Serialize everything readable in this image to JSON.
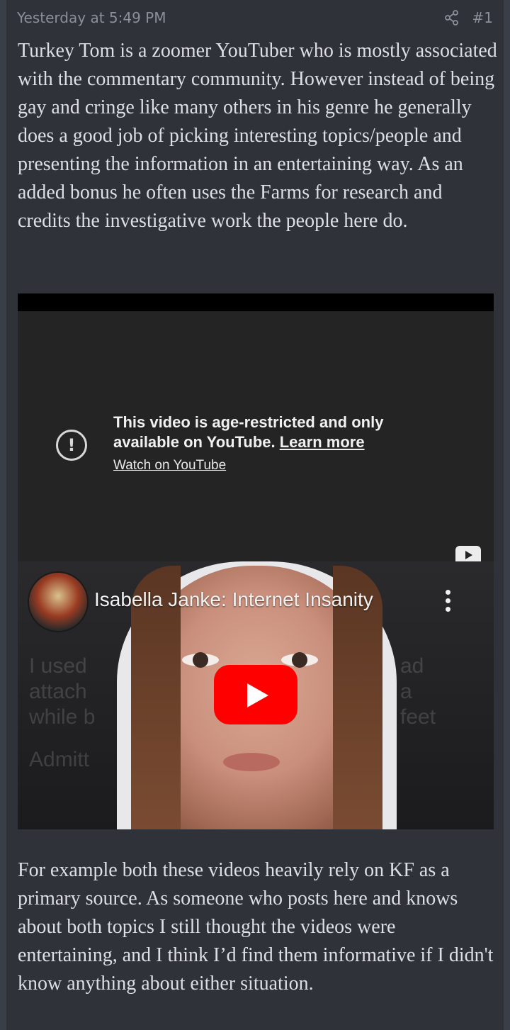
{
  "post": {
    "timestamp": "Yesterday at 5:49 PM",
    "post_number": "#1",
    "paragraph_1": "Turkey Tom is a zoomer YouTuber who is mostly associated with the commentary community. However instead of being gay and cringe like many others in his genre he generally does a good job of picking interesting topics/people and presenting the information in an entertaining way. As an added bonus he often uses the Farms for research and credits the investigative work the people here do.",
    "paragraph_2": "For example both these videos heavily rely on KF as a primary source. As someone who posts here and knows about both topics I still thought the videos were entertaining, and I think I’d find them informative if I didn't know anything about either situation."
  },
  "embed": {
    "restriction_message": "This video is age-restricted and only available on YouTube.",
    "learn_more_label": "Learn more",
    "watch_on_youtube_label": "Watch on YouTube",
    "video_title": "Isabella Janke: Internet Insanity"
  },
  "thumbnail_bg_text": {
    "left": "I used\nattach\nwhile b",
    "right": "ad\na\nfeet",
    "bottom_left": "Admitt"
  },
  "icons": {
    "share": "share-icon",
    "restriction": "exclamation-circle-icon",
    "youtube_logo": "youtube-logo-icon",
    "menu": "kebab-menu-icon",
    "play": "play-button-icon"
  },
  "colors": {
    "background": "#2f3239",
    "text": "#dcdfe4",
    "meta_text": "#8a8f98",
    "youtube_red": "#ff0000"
  }
}
